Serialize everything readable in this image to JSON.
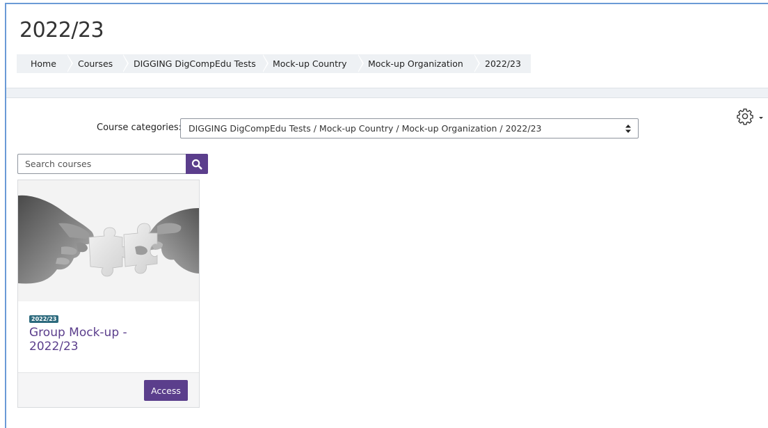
{
  "page": {
    "title": "2022/23"
  },
  "breadcrumb": [
    {
      "label": "Home"
    },
    {
      "label": "Courses"
    },
    {
      "label": "DIGGING DigCompEdu Tests"
    },
    {
      "label": "Mock-up Country"
    },
    {
      "label": "Mock-up Organization"
    },
    {
      "label": "2022/23"
    }
  ],
  "settings": {
    "icon": "gear-icon"
  },
  "categories": {
    "label": "Course categories:",
    "selected": "DIGGING DigCompEdu Tests / Mock-up Country / Mock-up Organization / 2022/23"
  },
  "search": {
    "placeholder": "Search courses",
    "icon": "search-icon"
  },
  "course": {
    "badge": "2022/23",
    "title": "Group Mock-up - 2022/23",
    "action": "Access"
  },
  "colors": {
    "accent": "#5b3e8c",
    "badge": "#2c6a7d",
    "frame": "#6a9ad6"
  }
}
